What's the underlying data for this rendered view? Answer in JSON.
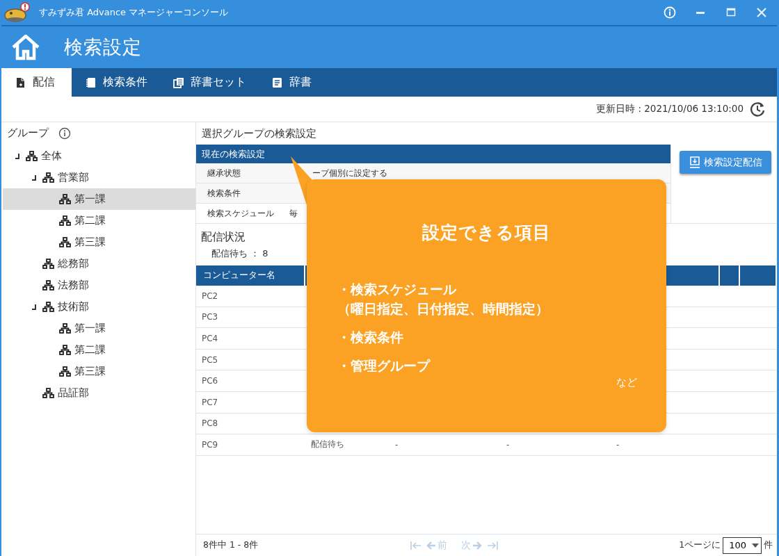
{
  "window": {
    "title": "すみずみ君 Advance マネージャーコンソール"
  },
  "header": {
    "title": "検索設定"
  },
  "tabs": [
    {
      "label": "配信",
      "selected": true
    },
    {
      "label": "検索条件",
      "selected": false
    },
    {
      "label": "辞書セット",
      "selected": false
    },
    {
      "label": "辞書",
      "selected": false
    }
  ],
  "updated": "更新日時 : 2021/10/06 13:10:00",
  "sidebar": {
    "title": "グループ",
    "tree": [
      {
        "label": "全体",
        "selected": false,
        "expanded": true,
        "children": [
          {
            "label": "営業部",
            "selected": false,
            "expanded": true,
            "children": [
              {
                "label": "第一課",
                "selected": true
              },
              {
                "label": "第二課",
                "selected": false
              },
              {
                "label": "第三課",
                "selected": false
              }
            ]
          },
          {
            "label": "総務部",
            "selected": false
          },
          {
            "label": "法務部",
            "selected": false
          },
          {
            "label": "技術部",
            "selected": false,
            "expanded": true,
            "children": [
              {
                "label": "第一課",
                "selected": false
              },
              {
                "label": "第二課",
                "selected": false
              },
              {
                "label": "第三課",
                "selected": false
              }
            ]
          },
          {
            "label": "品証部",
            "selected": false
          }
        ]
      }
    ]
  },
  "settings": {
    "title": "選択グループの検索設定",
    "panel_title": "現在の検索設定",
    "rows": [
      {
        "label": "継承状態",
        "value": "ープ個別に設定する"
      },
      {
        "label": "検索条件"
      },
      {
        "label": "検索スケジュール",
        "value": "毎"
      }
    ],
    "button": "検索設定配信"
  },
  "distribution": {
    "title": "配信状況",
    "pending": "配信待ち ： 8"
  },
  "table": {
    "columns": [
      "コンピューター名"
    ],
    "rows": [
      {
        "cells": [
          "PC2"
        ]
      },
      {
        "cells": [
          "PC3"
        ]
      },
      {
        "cells": [
          "PC4"
        ]
      },
      {
        "cells": [
          "PC5"
        ]
      },
      {
        "cells": [
          "PC6"
        ]
      },
      {
        "cells": [
          "PC7"
        ]
      },
      {
        "cells": [
          "PC8"
        ]
      },
      {
        "cells": [
          "PC9",
          "配信待ち",
          "-",
          "-",
          "-"
        ]
      }
    ]
  },
  "pager": {
    "summary": "8件中 1 - 8件",
    "prev": "前",
    "next": "次",
    "disabled": true,
    "per_page_label": "1ページに",
    "per_page": "100",
    "unit": "件"
  },
  "callout": {
    "title": "設定できる項目",
    "items": [
      {
        "text": "・検索スケジュール",
        "note": "（曜日指定、日付指定、時間指定）"
      },
      {
        "text": "・検索条件"
      },
      {
        "text": "・管理グループ"
      }
    ],
    "footer": "など"
  }
}
